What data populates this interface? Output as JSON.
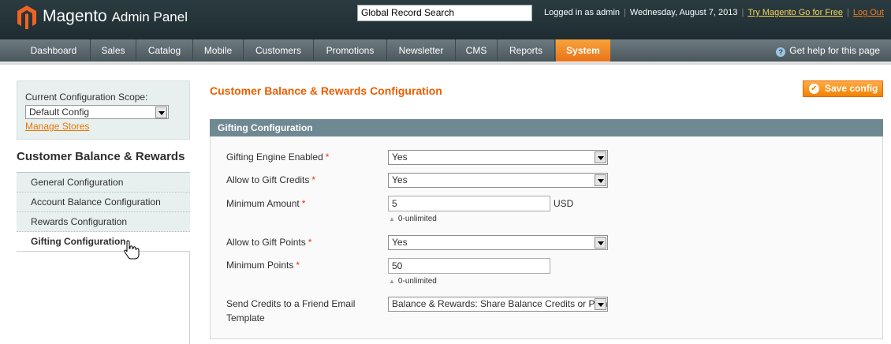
{
  "header": {
    "brand_main": "Magento",
    "brand_sub": "Admin Panel",
    "search_value": "Global Record Search",
    "logged_in": "Logged in as admin",
    "date": "Wednesday, August 7, 2013",
    "try_link": "Try Magento Go for Free",
    "logout": "Log Out"
  },
  "nav": {
    "items": [
      {
        "label": "Dashboard"
      },
      {
        "label": "Sales"
      },
      {
        "label": "Catalog"
      },
      {
        "label": "Mobile"
      },
      {
        "label": "Customers"
      },
      {
        "label": "Promotions"
      },
      {
        "label": "Newsletter"
      },
      {
        "label": "CMS"
      },
      {
        "label": "Reports"
      },
      {
        "label": "System",
        "active": true
      }
    ],
    "help": "Get help for this page",
    "help_icon": "question-circle-icon"
  },
  "sidebar": {
    "scope_label": "Current Configuration Scope:",
    "scope_value": "Default Config",
    "manage_stores": "Manage Stores",
    "title": "Customer Balance & Rewards",
    "tabs": [
      {
        "label": "General Configuration"
      },
      {
        "label": "Account Balance Configuration"
      },
      {
        "label": "Rewards Configuration"
      },
      {
        "label": "Gifting Configuration",
        "active": true
      }
    ]
  },
  "main": {
    "title": "Customer Balance & Rewards Configuration",
    "save_button": "Save config",
    "section_title": "Gifting Configuration",
    "fields": {
      "gifting_engine": {
        "label": "Gifting Engine Enabled",
        "value": "Yes"
      },
      "gift_credits": {
        "label": "Allow to Gift Credits",
        "value": "Yes"
      },
      "min_amount": {
        "label": "Minimum Amount",
        "value": "5",
        "unit": "USD",
        "note": "0-unlimited"
      },
      "gift_points": {
        "label": "Allow to Gift Points",
        "value": "Yes"
      },
      "min_points": {
        "label": "Minimum Points",
        "value": "50",
        "note": "0-unlimited"
      },
      "email_template": {
        "label_line1": "Send Credits to a Friend Email",
        "label_line2": "Template",
        "value": "Balance & Rewards: Share Balance Credits or Points"
      }
    },
    "required_mark": "*"
  },
  "colors": {
    "accent_orange": "#eb5e00",
    "header_bg": "#2b3c41",
    "nav_bg": "#5c6a6f",
    "section_head_bg": "#6f8992"
  }
}
